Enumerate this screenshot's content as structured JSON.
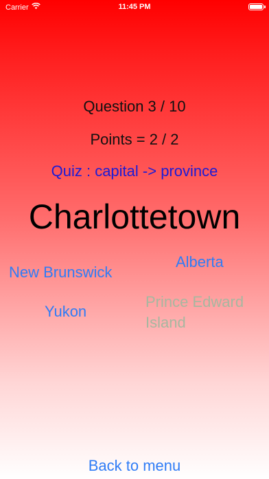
{
  "status_bar": {
    "carrier": "Carrier",
    "time": "11:45 PM"
  },
  "quiz": {
    "question": "Question 3 / 10",
    "points": "Points = 2 / 2",
    "mode": "Quiz : capital -> province",
    "prompt": "Charlottetown"
  },
  "answers": [
    {
      "label": "New Brunswick",
      "state": "enabled"
    },
    {
      "label": "Alberta",
      "state": "enabled"
    },
    {
      "label": "Yukon",
      "state": "enabled"
    },
    {
      "label": "Prince Edward Island",
      "state": "disabled"
    }
  ],
  "footer": {
    "back_label": "Back to menu"
  },
  "colors": {
    "gradient_top": "#ff0000",
    "gradient_bottom": "#ffffff",
    "button_blue": "#2f7cf6",
    "mode_text": "#1c1cd6",
    "disabled_answer": "#a7b7a0"
  },
  "icons": {
    "wifi": "wifi-icon",
    "battery": "battery-icon"
  }
}
